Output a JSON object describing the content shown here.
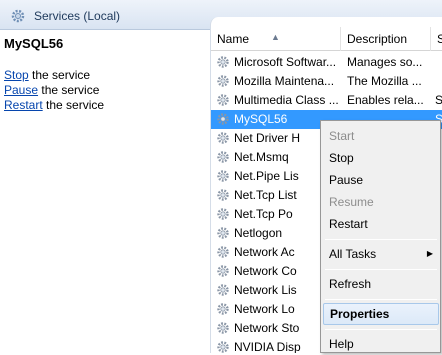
{
  "window": {
    "title": "Services (Local)"
  },
  "left_pane": {
    "service_name": "MySQL56",
    "actions": [
      {
        "link": "Stop",
        "text": " the service"
      },
      {
        "link": "Pause",
        "text": " the service"
      },
      {
        "link": "Restart",
        "text": " the service"
      }
    ]
  },
  "columns": {
    "name": "Name",
    "description": "Description",
    "status": "St"
  },
  "rows": [
    {
      "name": "Microsoft Softwar...",
      "description": "Manages so...",
      "status": ""
    },
    {
      "name": "Mozilla Maintena...",
      "description": "The Mozilla ...",
      "status": ""
    },
    {
      "name": "Multimedia Class ...",
      "description": "Enables rela...",
      "status": "St"
    },
    {
      "name": "MySQL56",
      "description": "",
      "status": "St"
    },
    {
      "name": "Net Driver H",
      "description": "",
      "status": ""
    },
    {
      "name": "Net.Msmq",
      "description": "",
      "status": ""
    },
    {
      "name": "Net.Pipe Lis",
      "description": "",
      "status": ""
    },
    {
      "name": "Net.Tcp List",
      "description": "",
      "status": ""
    },
    {
      "name": "Net.Tcp Po",
      "description": "",
      "status": ""
    },
    {
      "name": "Netlogon",
      "description": "",
      "status": ""
    },
    {
      "name": "Network Ac",
      "description": "",
      "status": ""
    },
    {
      "name": "Network Co",
      "description": "",
      "status": ""
    },
    {
      "name": "Network Lis",
      "description": "",
      "status": ""
    },
    {
      "name": "Network Lo",
      "description": "",
      "status": ""
    },
    {
      "name": "Network Sto",
      "description": "",
      "status": ""
    },
    {
      "name": "NVIDIA Disp",
      "description": "",
      "status": ""
    }
  ],
  "context_menu": {
    "start": "Start",
    "stop": "Stop",
    "pause": "Pause",
    "resume": "Resume",
    "restart": "Restart",
    "all_tasks": "All Tasks",
    "refresh": "Refresh",
    "properties": "Properties",
    "help": "Help"
  },
  "colors": {
    "selection": "#3399ff",
    "link": "#0645ad"
  }
}
